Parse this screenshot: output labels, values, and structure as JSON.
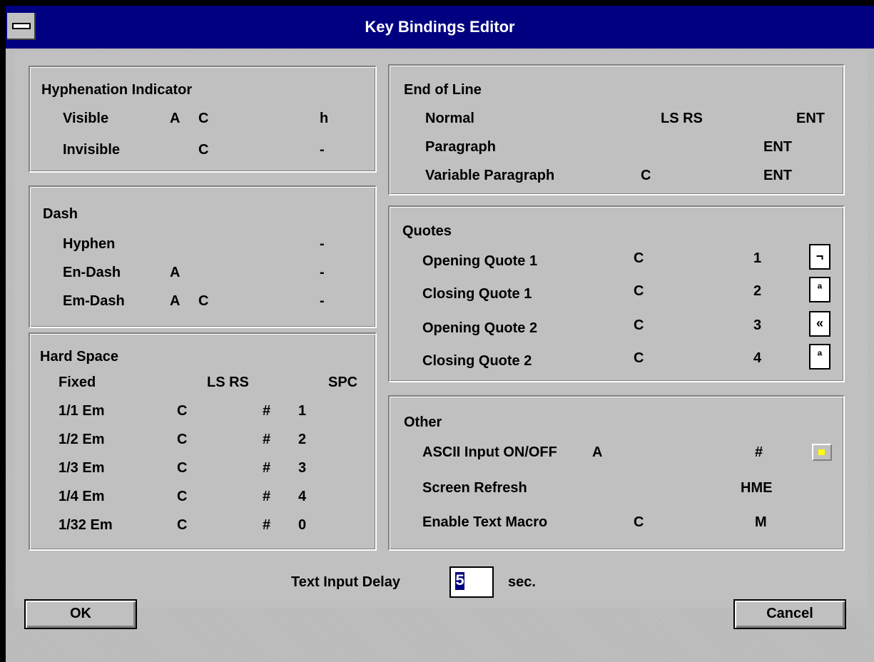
{
  "window": {
    "title": "Key Bindings Editor"
  },
  "hyphenation": {
    "title": "Hyphenation Indicator",
    "rows": [
      {
        "label": "Visible",
        "mod1": "A",
        "mod2": "C",
        "key": "h"
      },
      {
        "label": "Invisible",
        "mod1": "",
        "mod2": "C",
        "key": "-"
      }
    ]
  },
  "dash": {
    "title": "Dash",
    "rows": [
      {
        "label": "Hyphen",
        "mod1": "",
        "mod2": "",
        "key": "-"
      },
      {
        "label": "En-Dash",
        "mod1": "A",
        "mod2": "",
        "key": "-"
      },
      {
        "label": "Em-Dash",
        "mod1": "A",
        "mod2": "C",
        "key": "-"
      }
    ]
  },
  "hard_space": {
    "title": "Hard Space",
    "header": {
      "label": "Fixed",
      "mods": "LS RS",
      "key": "SPC"
    },
    "rows": [
      {
        "label": "1/1 Em",
        "mod": "C",
        "sym": "#",
        "key": "1"
      },
      {
        "label": "1/2 Em",
        "mod": "C",
        "sym": "#",
        "key": "2"
      },
      {
        "label": "1/3 Em",
        "mod": "C",
        "sym": "#",
        "key": "3"
      },
      {
        "label": "1/4 Em",
        "mod": "C",
        "sym": "#",
        "key": "4"
      },
      {
        "label": "1/32 Em",
        "mod": "C",
        "sym": "#",
        "key": "0"
      }
    ]
  },
  "end_of_line": {
    "title": "End of Line",
    "rows": [
      {
        "label": "Normal",
        "mod": "LS RS",
        "key": "ENT"
      },
      {
        "label": "Paragraph",
        "mod": "",
        "key": "ENT"
      },
      {
        "label": "Variable Paragraph",
        "mod": "C",
        "key": "ENT"
      }
    ]
  },
  "quotes": {
    "title": "Quotes",
    "rows": [
      {
        "label": "Opening Quote 1",
        "mod": "C",
        "key": "1",
        "glyph": "¬"
      },
      {
        "label": "Closing Quote 1",
        "mod": "C",
        "key": "2",
        "glyph": "ª"
      },
      {
        "label": "Opening Quote 2",
        "mod": "C",
        "key": "3",
        "glyph": "«"
      },
      {
        "label": "Closing Quote 2",
        "mod": "C",
        "key": "4",
        "glyph": "ª"
      }
    ]
  },
  "other": {
    "title": "Other",
    "rows": [
      {
        "label": "ASCII Input ON/OFF",
        "mod": "A",
        "key": "#"
      },
      {
        "label": "Screen Refresh",
        "mod": "",
        "key": "HME"
      },
      {
        "label": "Enable Text Macro",
        "mod": "C",
        "key": "M"
      }
    ],
    "indicator_color": "#ffff00"
  },
  "delay": {
    "label": "Text Input Delay",
    "value": "5",
    "unit": "sec."
  },
  "buttons": {
    "ok": "OK",
    "cancel": "Cancel"
  }
}
